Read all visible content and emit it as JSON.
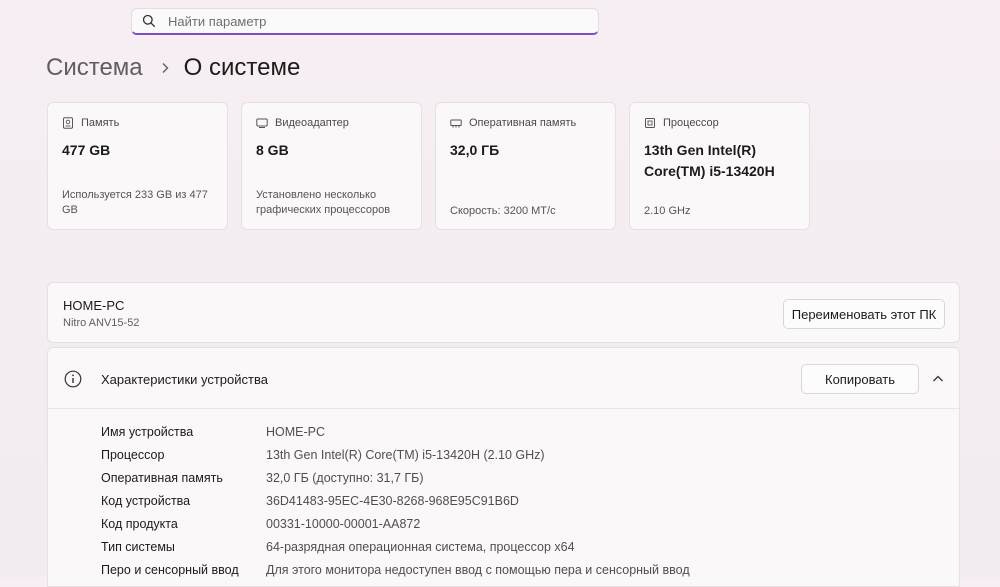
{
  "search": {
    "placeholder": "Найти параметр"
  },
  "breadcrumb": {
    "parent": "Система",
    "current": "О системе"
  },
  "cards": [
    {
      "label": "Память",
      "value": "477 GB",
      "sub": "Используется 233 GB из 477 GB",
      "icon": "storage-icon"
    },
    {
      "label": "Видеоадаптер",
      "value": "8 GB",
      "sub": "Установлено несколько графических процессоров",
      "icon": "gpu-icon"
    },
    {
      "label": "Оперативная память",
      "value": "32,0 ГБ",
      "sub": "Скорость: 3200 MT/c",
      "icon": "ram-icon"
    },
    {
      "label": "Процессор",
      "value": "13th Gen Intel(R) Core(TM) i5-13420H",
      "sub": "2.10 GHz",
      "icon": "cpu-icon"
    }
  ],
  "device": {
    "name": "HOME-PC",
    "model": "Nitro ANV15-52",
    "rename_label": "Переименовать этот ПК"
  },
  "specs": {
    "title": "Характеристики устройства",
    "copy_label": "Копировать",
    "rows": [
      {
        "key": "Имя устройства",
        "value": "HOME-PC"
      },
      {
        "key": "Процессор",
        "value": "13th Gen Intel(R) Core(TM) i5-13420H (2.10 GHz)"
      },
      {
        "key": "Оперативная память",
        "value": "32,0 ГБ (доступно: 31,7 ГБ)"
      },
      {
        "key": "Код устройства",
        "value": "36D41483-95EC-4E30-8268-968E95C91B6D"
      },
      {
        "key": "Код продукта",
        "value": "00331-10000-00001-AA872"
      },
      {
        "key": "Тип системы",
        "value": "64-разрядная операционная система, процессор x64"
      },
      {
        "key": "Перо и сенсорный ввод",
        "value": "Для этого монитора недоступен ввод с помощью пера и сенсорный ввод"
      }
    ]
  },
  "colors": {
    "accent": "#7b4fc2",
    "background": "#f4edf1",
    "panel": "#fbf8fa"
  }
}
